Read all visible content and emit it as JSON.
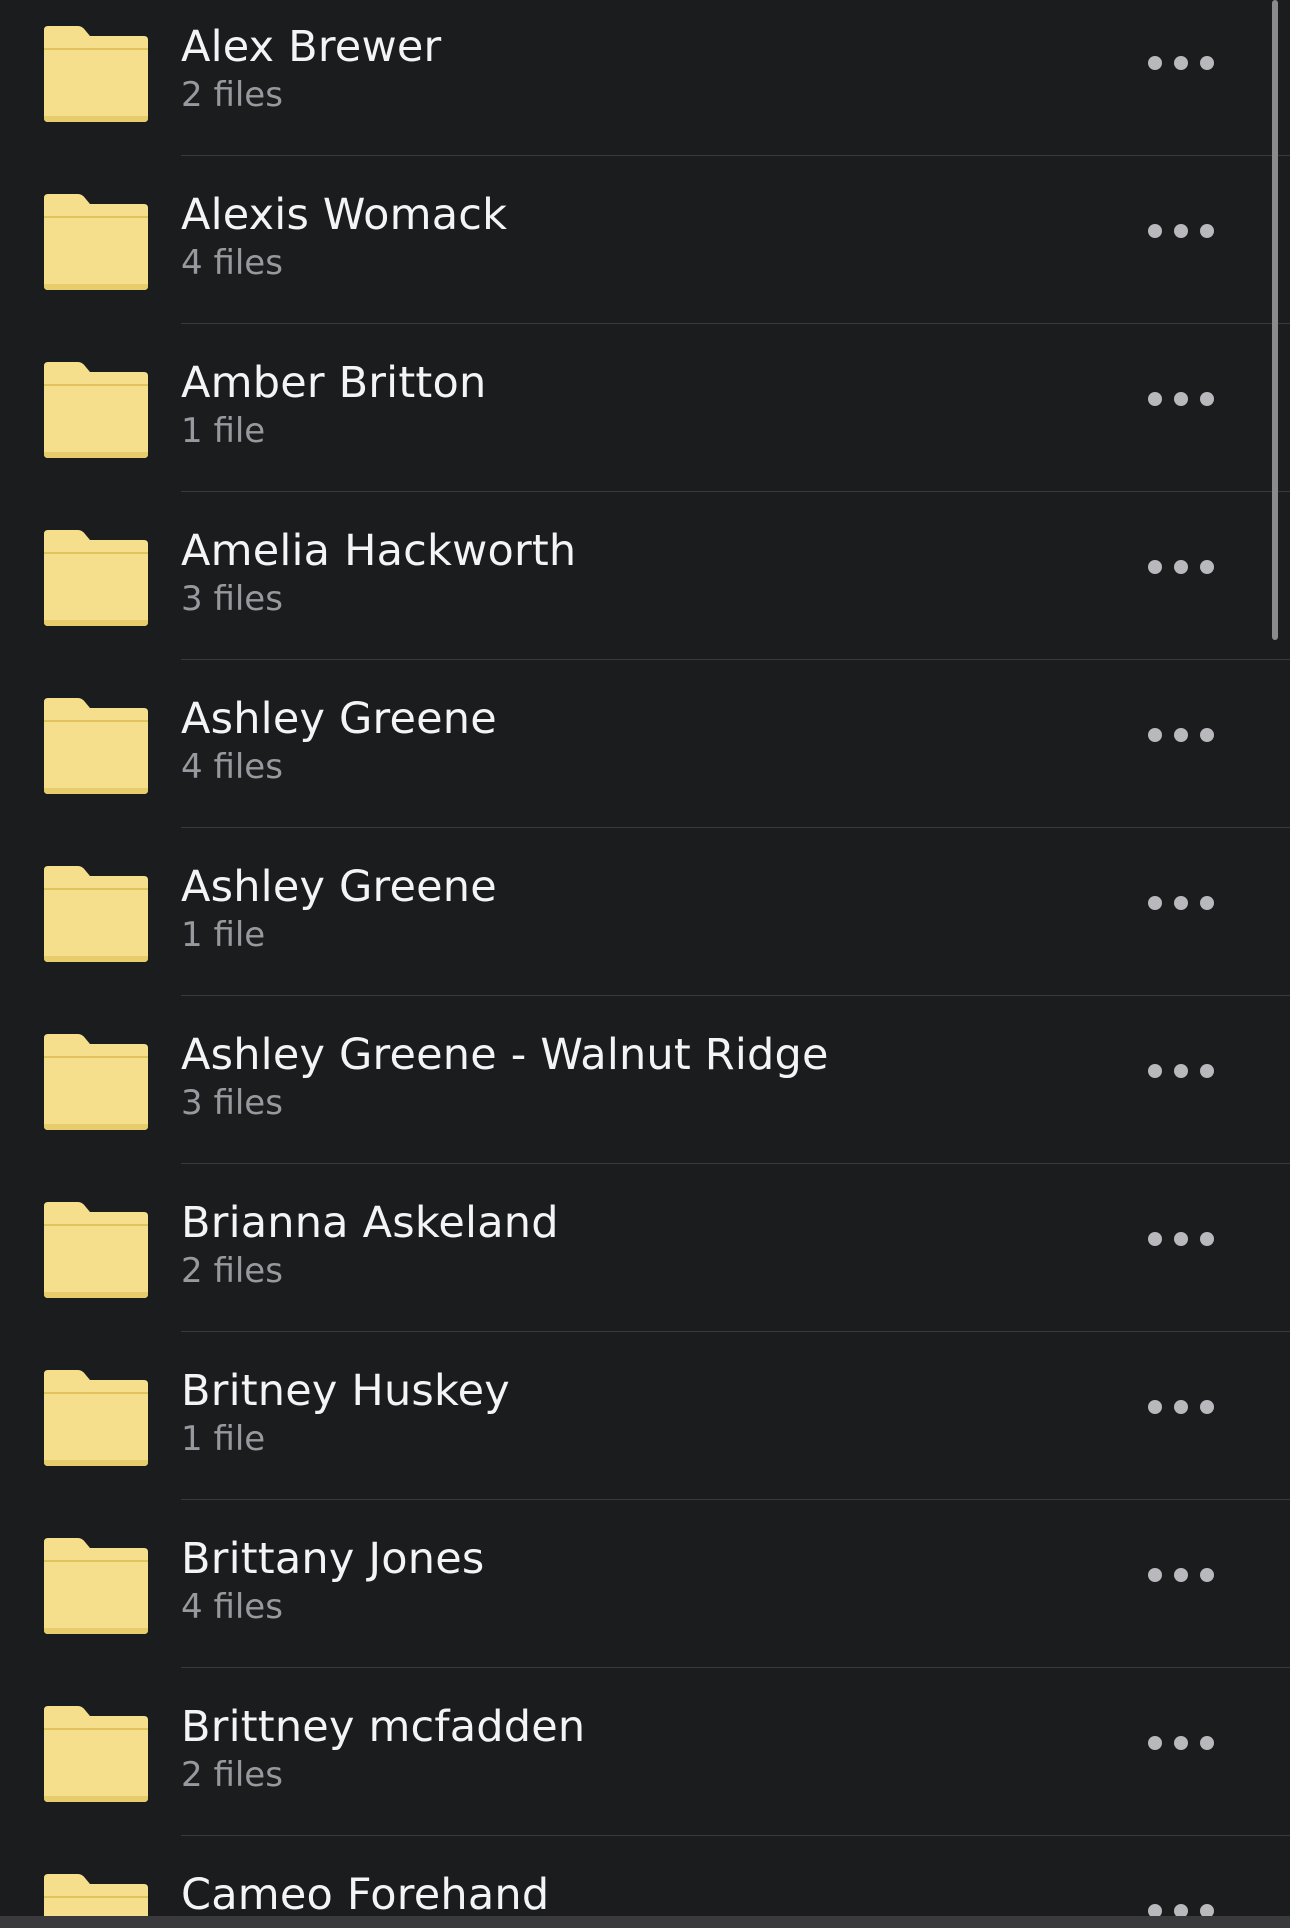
{
  "folders": [
    {
      "name": "Alex Brewer",
      "count": "2 files"
    },
    {
      "name": "Alexis Womack",
      "count": "4 files"
    },
    {
      "name": "Amber Britton",
      "count": "1 file"
    },
    {
      "name": "Amelia Hackworth",
      "count": "3 files"
    },
    {
      "name": "Ashley Greene",
      "count": "4 files"
    },
    {
      "name": "Ashley Greene",
      "count": "1 file"
    },
    {
      "name": "Ashley Greene - Walnut Ridge",
      "count": "3 files"
    },
    {
      "name": "Brianna Askeland",
      "count": "2 files"
    },
    {
      "name": "Britney Huskey",
      "count": "1 file"
    },
    {
      "name": "Brittany Jones",
      "count": "4 files"
    },
    {
      "name": "Brittney mcfadden",
      "count": "2 files"
    },
    {
      "name": "Cameo Forehand",
      "count": ""
    }
  ],
  "icons": {
    "folder": "folder-icon",
    "more": "more-options-icon"
  },
  "colors": {
    "background": "#1b1c1e",
    "folder_fill": "#f5df8d",
    "folder_edge": "#e2c25a",
    "name_text": "#f4f4f6",
    "count_text": "#98989e",
    "separator": "#3a3a3d"
  }
}
